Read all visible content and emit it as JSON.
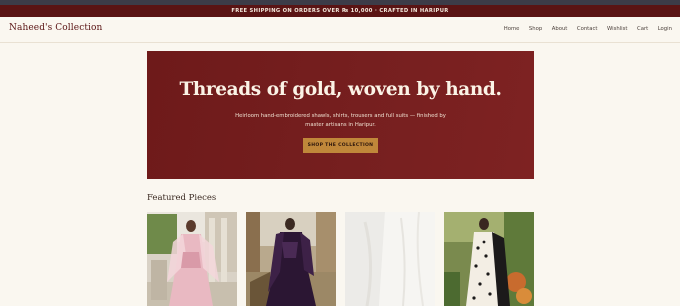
{
  "promo": {
    "text": "FREE SHIPPING ON ORDERS OVER ₨ 10,000 · CRAFTED IN HARIPUR"
  },
  "header": {
    "brand": "Naheed's Collection",
    "nav": [
      "Home",
      "Shop",
      "About",
      "Contact",
      "Wishlist",
      "Cart",
      "Login"
    ]
  },
  "hero": {
    "title": "Threads of gold, woven by hand.",
    "subtitle": "Heirloom hand-embroidered shawls, shirts, trousers and full suits — finished by master artisans in Haripur.",
    "cta": "SHOP THE COLLECTION"
  },
  "featured": {
    "title": "Featured Pieces"
  },
  "colors": {
    "brand": "#5a1414",
    "hero_bg": "#761f1f",
    "cta_bg": "#c0873a",
    "page_bg": "#faf7f0"
  }
}
